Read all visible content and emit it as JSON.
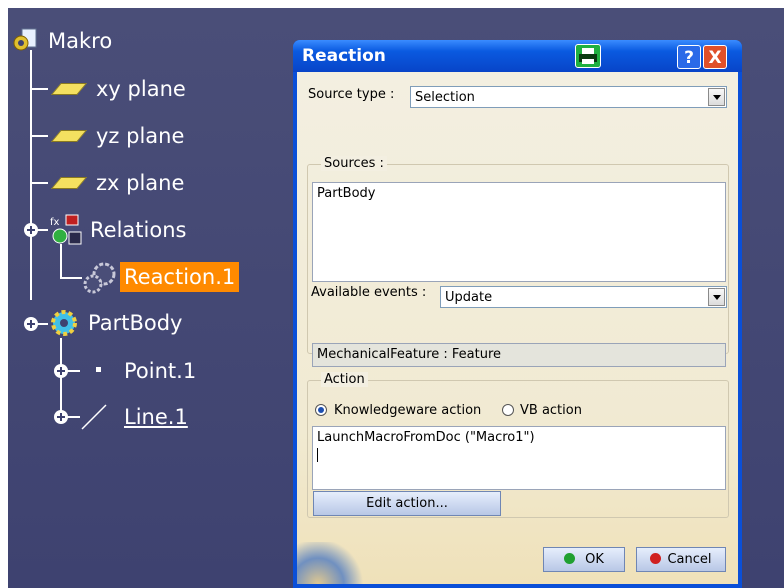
{
  "tree": {
    "root": "Makro",
    "planes": [
      "xy plane",
      "yz plane",
      "zx plane"
    ],
    "relations": "Relations",
    "reaction": "Reaction.1",
    "partbody": "PartBody",
    "point": "Point.1",
    "line": "Line.1"
  },
  "dialog": {
    "title": "Reaction",
    "help_label": "?",
    "close_label": "X",
    "source_type_label": "Source type :",
    "source_type_value": "Selection",
    "sources_label": "Sources :",
    "sources_text": "PartBody",
    "events_label": "Available events :",
    "events_value": "Update",
    "feature_info": "MechanicalFeature :  Feature",
    "action_label": "Action",
    "radio_kw": "Knowledgeware action",
    "radio_vb": "VB action",
    "action_code": "LaunchMacroFromDoc (\"Macro1\")",
    "edit_action": "Edit action...",
    "ok": "OK",
    "cancel": "Cancel"
  },
  "colors": {
    "selection": "#ff8a00",
    "titlebar": "#0a5ae0",
    "background": "#3e4270"
  }
}
